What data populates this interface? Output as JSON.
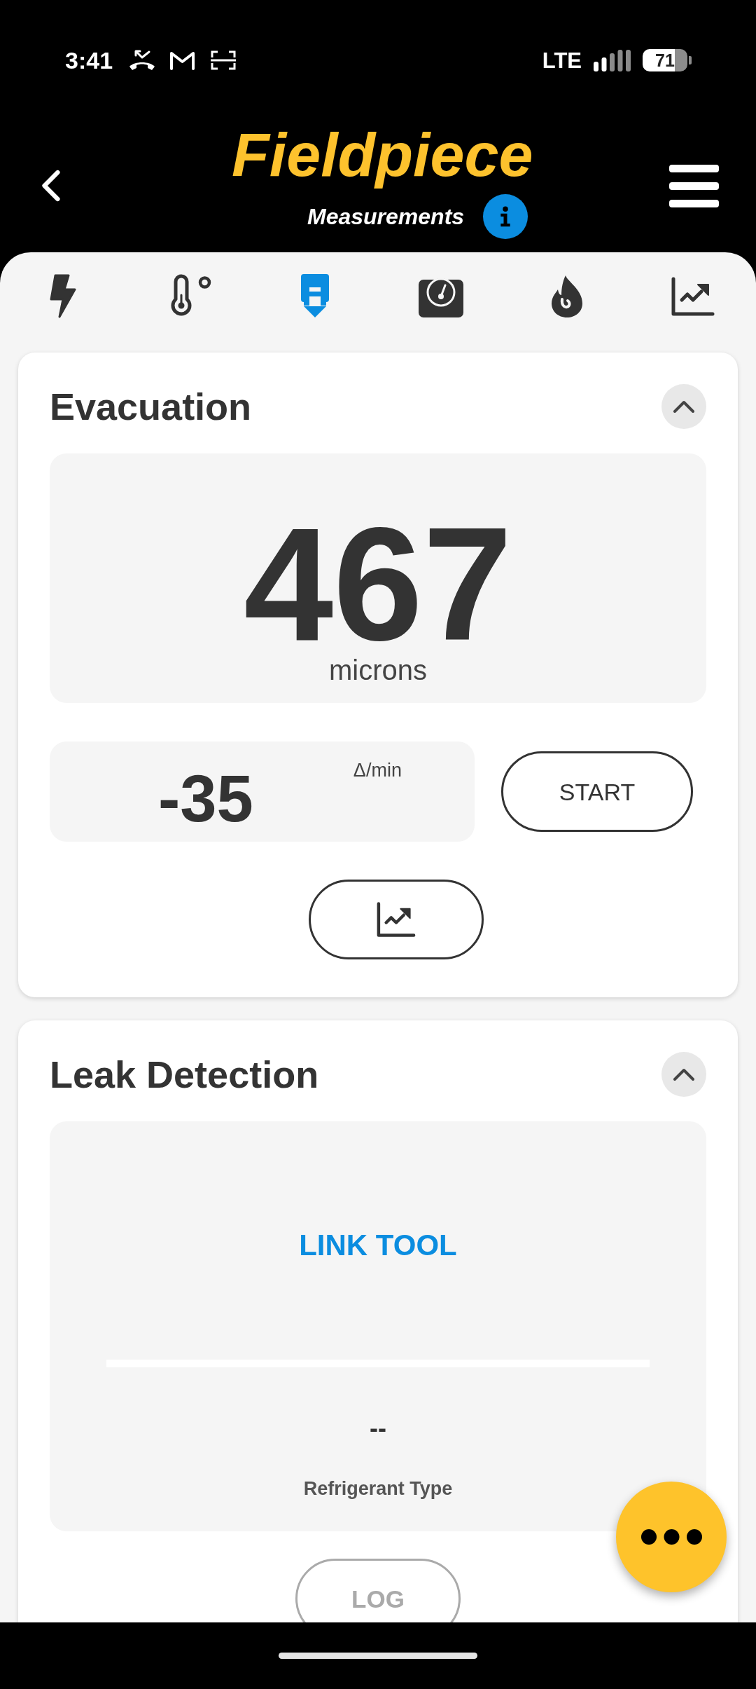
{
  "status_bar": {
    "time": "3:41",
    "network": "LTE",
    "battery": "71"
  },
  "header": {
    "logo": "Fieldpiece",
    "subtitle": "Measurements"
  },
  "tabs": [
    {
      "kind": "bolt",
      "selected": false
    },
    {
      "kind": "thermometer",
      "selected": false
    },
    {
      "kind": "evacuate",
      "selected": true
    },
    {
      "kind": "gauge",
      "selected": false
    },
    {
      "kind": "flame",
      "selected": false
    },
    {
      "kind": "chart",
      "selected": false
    }
  ],
  "evacuation": {
    "title": "Evacuation",
    "expanded": true,
    "reading": "467",
    "unit": "microns",
    "rate": "-35",
    "rate_unit": "Δ/min",
    "start_button": "START"
  },
  "leak_detection": {
    "title": "Leak Detection",
    "expanded": true,
    "link_button": "LINK TOOL",
    "value": "--",
    "value_label": "Refrigerant Type",
    "log_button": {
      "label": "LOG",
      "disabled": true
    }
  }
}
